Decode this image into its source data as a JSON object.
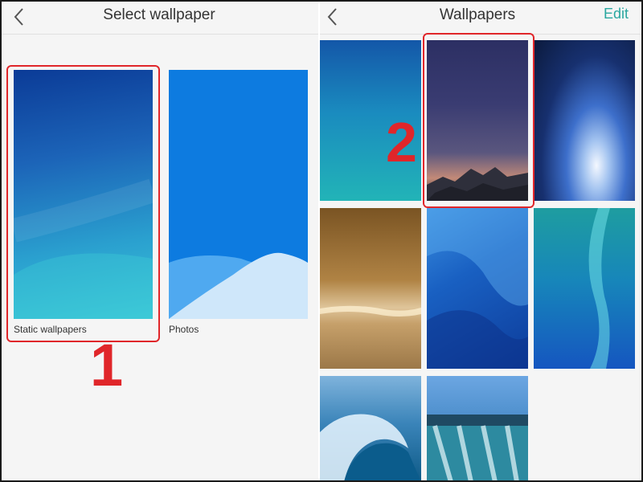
{
  "left_screen": {
    "title": "Select wallpaper",
    "options": [
      {
        "label": "Static wallpapers"
      },
      {
        "label": "Photos"
      }
    ],
    "step_marker": "1"
  },
  "right_screen": {
    "title": "Wallpapers",
    "edit_label": "Edit",
    "step_marker": "2"
  },
  "icons": {
    "back": "chevron-left-icon"
  },
  "colors": {
    "accent": "#2aa7a0",
    "annotation": "#e0262a"
  }
}
